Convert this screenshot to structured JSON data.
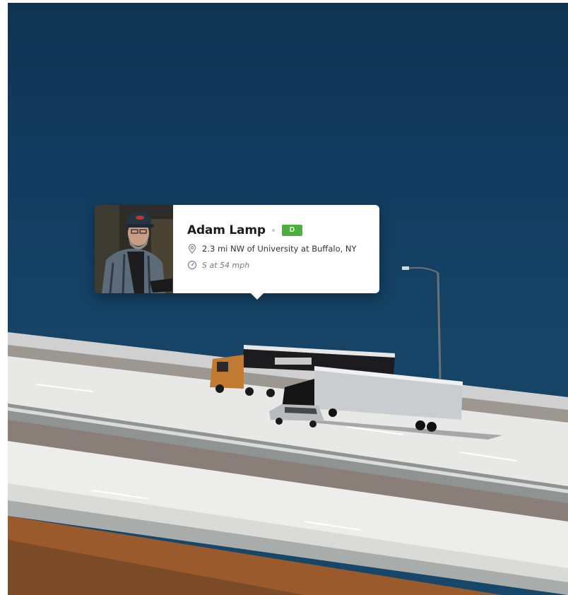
{
  "driver_popup": {
    "name": "Adam Lamp",
    "status_badge": "D",
    "location": "2.3 mi NW of University at Buffalo, NY",
    "speed": "S at 54 mph"
  },
  "icons": {
    "location": "map-pin-icon",
    "speed": "speedometer-icon"
  },
  "colors": {
    "badge_green": "#4cae3c",
    "water_blue": "#154263",
    "card_background": "#ffffff"
  }
}
